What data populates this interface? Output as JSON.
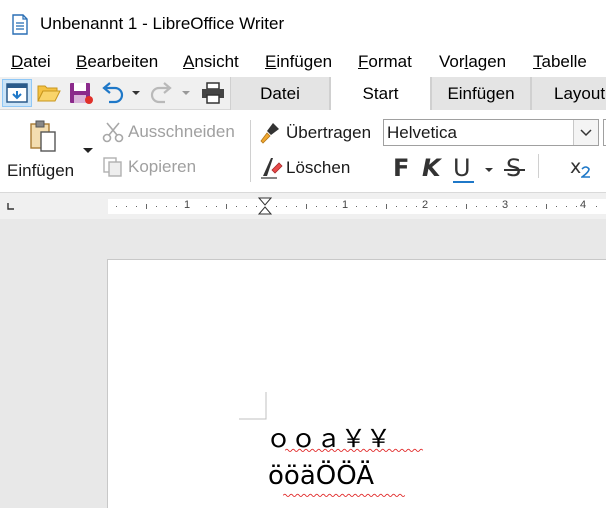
{
  "window": {
    "title": "Unbenannt 1 - LibreOffice Writer"
  },
  "menubar": {
    "items": [
      {
        "label": "Datei",
        "ul": "D",
        "rest": "atei"
      },
      {
        "label": "Bearbeiten",
        "ul": "B",
        "rest": "earbeiten"
      },
      {
        "label": "Ansicht",
        "ul": "A",
        "rest": "nsicht"
      },
      {
        "label": "Einfügen",
        "ul": "E",
        "rest": "infügen"
      },
      {
        "label": "Format",
        "ul": "F",
        "rest": "ormat"
      },
      {
        "label": "Vorlagen",
        "pre": "Vor",
        "ul": "l",
        "rest": "agen"
      },
      {
        "label": "Tabelle",
        "ul": "T",
        "rest": "abelle"
      }
    ]
  },
  "tabs": [
    {
      "label": "Datei",
      "active": false
    },
    {
      "label": "Start",
      "active": true
    },
    {
      "label": "Einfügen",
      "active": false
    },
    {
      "label": "Layout",
      "active": false
    }
  ],
  "ribbon": {
    "paste_label": "Einfügen",
    "cut_label": "Ausschneiden",
    "copy_label": "Kopieren",
    "clone_label": "Übertragen",
    "clear_label": "Löschen",
    "font_name": "Helvetica",
    "bold_label": "F",
    "italic_label": "K",
    "underline_label": "U",
    "strike_label": "S",
    "subscript_label": "x"
  },
  "ruler": {
    "labels": [
      "1",
      "1",
      "2",
      "3",
      "4"
    ]
  },
  "document": {
    "line1": "ｏｏａ￥￥",
    "line2": "ööäÖÖÄ"
  }
}
